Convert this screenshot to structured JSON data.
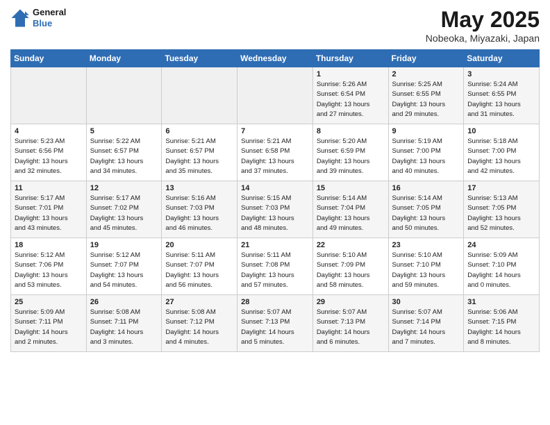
{
  "header": {
    "logo_line1": "General",
    "logo_line2": "Blue",
    "month": "May 2025",
    "location": "Nobeoka, Miyazaki, Japan"
  },
  "weekdays": [
    "Sunday",
    "Monday",
    "Tuesday",
    "Wednesday",
    "Thursday",
    "Friday",
    "Saturday"
  ],
  "weeks": [
    [
      {
        "num": "",
        "info": ""
      },
      {
        "num": "",
        "info": ""
      },
      {
        "num": "",
        "info": ""
      },
      {
        "num": "",
        "info": ""
      },
      {
        "num": "1",
        "info": "Sunrise: 5:26 AM\nSunset: 6:54 PM\nDaylight: 13 hours\nand 27 minutes."
      },
      {
        "num": "2",
        "info": "Sunrise: 5:25 AM\nSunset: 6:55 PM\nDaylight: 13 hours\nand 29 minutes."
      },
      {
        "num": "3",
        "info": "Sunrise: 5:24 AM\nSunset: 6:55 PM\nDaylight: 13 hours\nand 31 minutes."
      }
    ],
    [
      {
        "num": "4",
        "info": "Sunrise: 5:23 AM\nSunset: 6:56 PM\nDaylight: 13 hours\nand 32 minutes."
      },
      {
        "num": "5",
        "info": "Sunrise: 5:22 AM\nSunset: 6:57 PM\nDaylight: 13 hours\nand 34 minutes."
      },
      {
        "num": "6",
        "info": "Sunrise: 5:21 AM\nSunset: 6:57 PM\nDaylight: 13 hours\nand 35 minutes."
      },
      {
        "num": "7",
        "info": "Sunrise: 5:21 AM\nSunset: 6:58 PM\nDaylight: 13 hours\nand 37 minutes."
      },
      {
        "num": "8",
        "info": "Sunrise: 5:20 AM\nSunset: 6:59 PM\nDaylight: 13 hours\nand 39 minutes."
      },
      {
        "num": "9",
        "info": "Sunrise: 5:19 AM\nSunset: 7:00 PM\nDaylight: 13 hours\nand 40 minutes."
      },
      {
        "num": "10",
        "info": "Sunrise: 5:18 AM\nSunset: 7:00 PM\nDaylight: 13 hours\nand 42 minutes."
      }
    ],
    [
      {
        "num": "11",
        "info": "Sunrise: 5:17 AM\nSunset: 7:01 PM\nDaylight: 13 hours\nand 43 minutes."
      },
      {
        "num": "12",
        "info": "Sunrise: 5:17 AM\nSunset: 7:02 PM\nDaylight: 13 hours\nand 45 minutes."
      },
      {
        "num": "13",
        "info": "Sunrise: 5:16 AM\nSunset: 7:03 PM\nDaylight: 13 hours\nand 46 minutes."
      },
      {
        "num": "14",
        "info": "Sunrise: 5:15 AM\nSunset: 7:03 PM\nDaylight: 13 hours\nand 48 minutes."
      },
      {
        "num": "15",
        "info": "Sunrise: 5:14 AM\nSunset: 7:04 PM\nDaylight: 13 hours\nand 49 minutes."
      },
      {
        "num": "16",
        "info": "Sunrise: 5:14 AM\nSunset: 7:05 PM\nDaylight: 13 hours\nand 50 minutes."
      },
      {
        "num": "17",
        "info": "Sunrise: 5:13 AM\nSunset: 7:05 PM\nDaylight: 13 hours\nand 52 minutes."
      }
    ],
    [
      {
        "num": "18",
        "info": "Sunrise: 5:12 AM\nSunset: 7:06 PM\nDaylight: 13 hours\nand 53 minutes."
      },
      {
        "num": "19",
        "info": "Sunrise: 5:12 AM\nSunset: 7:07 PM\nDaylight: 13 hours\nand 54 minutes."
      },
      {
        "num": "20",
        "info": "Sunrise: 5:11 AM\nSunset: 7:07 PM\nDaylight: 13 hours\nand 56 minutes."
      },
      {
        "num": "21",
        "info": "Sunrise: 5:11 AM\nSunset: 7:08 PM\nDaylight: 13 hours\nand 57 minutes."
      },
      {
        "num": "22",
        "info": "Sunrise: 5:10 AM\nSunset: 7:09 PM\nDaylight: 13 hours\nand 58 minutes."
      },
      {
        "num": "23",
        "info": "Sunrise: 5:10 AM\nSunset: 7:10 PM\nDaylight: 13 hours\nand 59 minutes."
      },
      {
        "num": "24",
        "info": "Sunrise: 5:09 AM\nSunset: 7:10 PM\nDaylight: 14 hours\nand 0 minutes."
      }
    ],
    [
      {
        "num": "25",
        "info": "Sunrise: 5:09 AM\nSunset: 7:11 PM\nDaylight: 14 hours\nand 2 minutes."
      },
      {
        "num": "26",
        "info": "Sunrise: 5:08 AM\nSunset: 7:11 PM\nDaylight: 14 hours\nand 3 minutes."
      },
      {
        "num": "27",
        "info": "Sunrise: 5:08 AM\nSunset: 7:12 PM\nDaylight: 14 hours\nand 4 minutes."
      },
      {
        "num": "28",
        "info": "Sunrise: 5:07 AM\nSunset: 7:13 PM\nDaylight: 14 hours\nand 5 minutes."
      },
      {
        "num": "29",
        "info": "Sunrise: 5:07 AM\nSunset: 7:13 PM\nDaylight: 14 hours\nand 6 minutes."
      },
      {
        "num": "30",
        "info": "Sunrise: 5:07 AM\nSunset: 7:14 PM\nDaylight: 14 hours\nand 7 minutes."
      },
      {
        "num": "31",
        "info": "Sunrise: 5:06 AM\nSunset: 7:15 PM\nDaylight: 14 hours\nand 8 minutes."
      }
    ]
  ]
}
